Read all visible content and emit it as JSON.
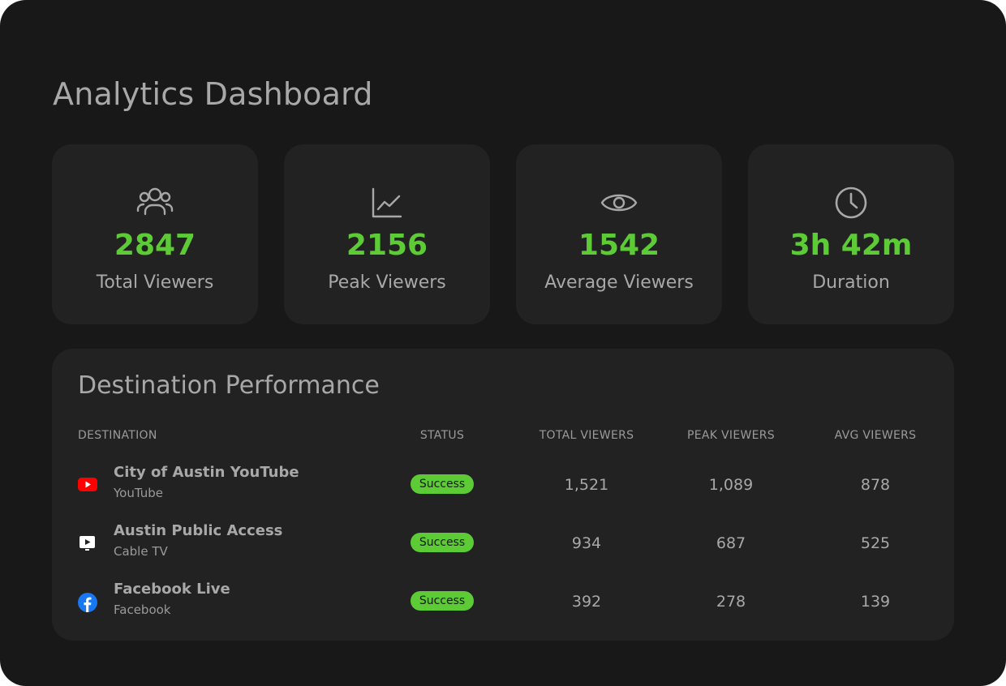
{
  "page": {
    "title": "Analytics Dashboard"
  },
  "stats": [
    {
      "icon": "users-icon",
      "value": "2847",
      "label": "Total Viewers"
    },
    {
      "icon": "line-chart-icon",
      "value": "2156",
      "label": "Peak Viewers"
    },
    {
      "icon": "eye-icon",
      "value": "1542",
      "label": "Average Viewers"
    },
    {
      "icon": "clock-icon",
      "value": "3h 42m",
      "label": "Duration"
    }
  ],
  "performance": {
    "title": "Destination Performance",
    "columns": {
      "destination": "DESTINATION",
      "status": "STATUS",
      "total": "TOTAL VIEWERS",
      "peak": "PEAK VIEWERS",
      "avg": "AVG VIEWERS"
    },
    "rows": [
      {
        "icon": "youtube-icon",
        "name": "City of Austin YouTube",
        "type": "YouTube",
        "status": "Success",
        "total": "1,521",
        "peak": "1,089",
        "avg": "878"
      },
      {
        "icon": "cable-tv-icon",
        "name": "Austin Public Access",
        "type": "Cable TV",
        "status": "Success",
        "total": "934",
        "peak": "687",
        "avg": "525"
      },
      {
        "icon": "facebook-icon",
        "name": "Facebook Live",
        "type": "Facebook",
        "status": "Success",
        "total": "392",
        "peak": "278",
        "avg": "139"
      }
    ]
  },
  "colors": {
    "background": "#181818",
    "card": "#222222",
    "accent": "#5ccb35",
    "text": "#a8a8a8",
    "youtube": "#ff0000",
    "facebook": "#1877f2"
  }
}
